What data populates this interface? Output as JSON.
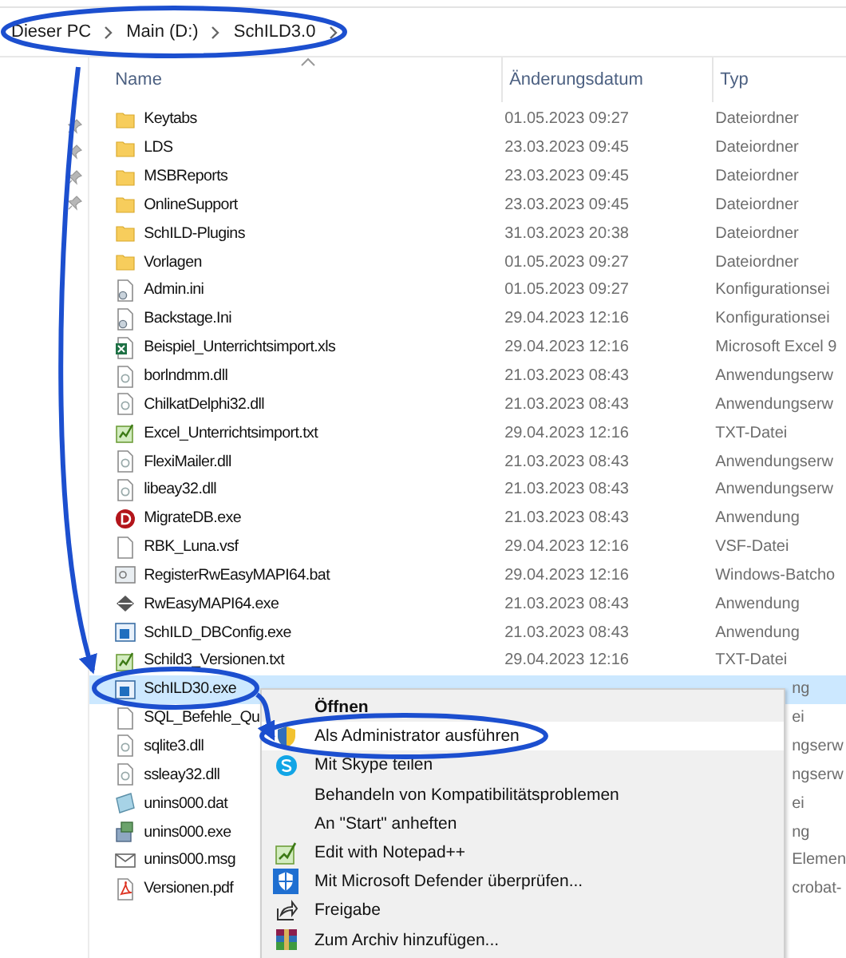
{
  "breadcrumb": [
    "Dieser PC",
    "Main (D:)",
    "SchILD3.0"
  ],
  "columns": [
    "Name",
    "Änderungsdatum",
    "Typ"
  ],
  "files": [
    {
      "name": "Keytabs",
      "date": "01.05.2023 09:27",
      "type": "Dateiordner",
      "kind": "folder",
      "selected": false
    },
    {
      "name": "LDS",
      "date": "23.03.2023 09:45",
      "type": "Dateiordner",
      "kind": "folder",
      "selected": false
    },
    {
      "name": "MSBReports",
      "date": "23.03.2023 09:45",
      "type": "Dateiordner",
      "kind": "folder",
      "selected": false
    },
    {
      "name": "OnlineSupport",
      "date": "23.03.2023 09:45",
      "type": "Dateiordner",
      "kind": "folder",
      "selected": false
    },
    {
      "name": "SchILD-Plugins",
      "date": "31.03.2023 20:38",
      "type": "Dateiordner",
      "kind": "folder",
      "selected": false
    },
    {
      "name": "Vorlagen",
      "date": "01.05.2023 09:27",
      "type": "Dateiordner",
      "kind": "folder",
      "selected": false
    },
    {
      "name": "Admin.ini",
      "date": "01.05.2023 09:27",
      "type": "Konfigurationsei",
      "kind": "config",
      "selected": false
    },
    {
      "name": "Backstage.Ini",
      "date": "29.04.2023 12:16",
      "type": "Konfigurationsei",
      "kind": "config",
      "selected": false
    },
    {
      "name": "Beispiel_Unterrichtsimport.xls",
      "date": "29.04.2023 12:16",
      "type": "Microsoft Excel 9",
      "kind": "spreadsheet",
      "selected": false
    },
    {
      "name": "borlndmm.dll",
      "date": "21.03.2023 08:43",
      "type": "Anwendungserw",
      "kind": "library",
      "selected": false
    },
    {
      "name": "ChilkatDelphi32.dll",
      "date": "21.03.2023 08:43",
      "type": "Anwendungserw",
      "kind": "library",
      "selected": false
    },
    {
      "name": "Excel_Unterrichtsimport.txt",
      "date": "29.04.2023 12:16",
      "type": "TXT-Datei",
      "kind": "text",
      "selected": false
    },
    {
      "name": "FlexiMailer.dll",
      "date": "21.03.2023 08:43",
      "type": "Anwendungserw",
      "kind": "library",
      "selected": false
    },
    {
      "name": "libeay32.dll",
      "date": "21.03.2023 08:43",
      "type": "Anwendungserw",
      "kind": "library",
      "selected": false
    },
    {
      "name": "MigrateDB.exe",
      "date": "21.03.2023 08:43",
      "type": "Anwendung",
      "kind": "app-d",
      "selected": false
    },
    {
      "name": "RBK_Luna.vsf",
      "date": "29.04.2023 12:16",
      "type": "VSF-Datei",
      "kind": "plain",
      "selected": false
    },
    {
      "name": "RegisterRwEasyMAPI64.bat",
      "date": "29.04.2023 12:16",
      "type": "Windows-Batcho",
      "kind": "batch",
      "selected": false
    },
    {
      "name": "RwEasyMAPI64.exe",
      "date": "21.03.2023 08:43",
      "type": "Anwendung",
      "kind": "program",
      "selected": false
    },
    {
      "name": "SchILD_DBConfig.exe",
      "date": "21.03.2023 08:43",
      "type": "Anwendung",
      "kind": "window-app",
      "selected": false
    },
    {
      "name": "Schild3_Versionen.txt",
      "date": "29.04.2023 12:16",
      "type": "TXT-Datei",
      "kind": "text",
      "selected": false
    },
    {
      "name": "SchILD30.exe",
      "type_tail": "ng",
      "kind": "window-app",
      "selected": true
    },
    {
      "name": "SQL_Befehle_Qu",
      "type_tail": "ei",
      "kind": "plain",
      "selected": false
    },
    {
      "name": "sqlite3.dll",
      "type_tail": "ngserw",
      "kind": "library",
      "selected": false
    },
    {
      "name": "ssleay32.dll",
      "type_tail": "ngserw",
      "kind": "library",
      "selected": false
    },
    {
      "name": "unins000.dat",
      "type_tail": "ei",
      "kind": "data",
      "selected": false
    },
    {
      "name": "unins000.exe",
      "type_tail": "ng",
      "kind": "installer",
      "selected": false
    },
    {
      "name": "unins000.msg",
      "type_tail": "Elemen",
      "kind": "message",
      "selected": false
    },
    {
      "name": "Versionen.pdf",
      "type_tail": "crobat-",
      "kind": "pdf",
      "selected": false
    }
  ],
  "menu": [
    {
      "label": "Öffnen",
      "kind": "none",
      "default": true,
      "highlighted": false
    },
    {
      "label": "Als Administrator ausführen",
      "kind": "shield",
      "default": false,
      "highlighted": true
    },
    {
      "label": "Mit Skype teilen",
      "kind": "skype",
      "default": false,
      "highlighted": false
    },
    {
      "label": "Behandeln von Kompatibilitätsproblemen",
      "kind": "none",
      "default": false,
      "highlighted": false
    },
    {
      "label": "An \"Start\" anheften",
      "kind": "none",
      "default": false,
      "highlighted": false
    },
    {
      "label": "Edit with Notepad++",
      "kind": "notepad",
      "default": false,
      "highlighted": false
    },
    {
      "label": "Mit Microsoft Defender überprüfen...",
      "kind": "defender",
      "default": false,
      "highlighted": false
    },
    {
      "label": "Freigabe",
      "kind": "share",
      "default": false,
      "highlighted": false
    },
    {
      "label": "Zum Archiv hinzufügen...",
      "kind": "archive",
      "default": false,
      "highlighted": false
    }
  ]
}
